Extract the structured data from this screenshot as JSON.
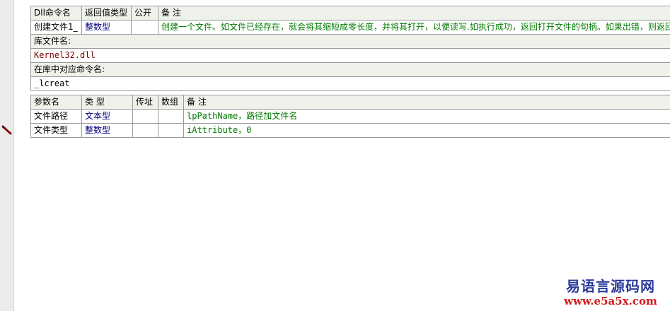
{
  "dll_header": {
    "col_name": "Dll命令名",
    "col_return": "返回值类型",
    "col_public": "公开",
    "col_remark": "备 注"
  },
  "dll_row": {
    "name": "创建文件1_",
    "return_type": "整数型",
    "public": "",
    "remark": "创建一个文件。如文件已经存在，就会将其缩短成零长度，并将其打开，以便读写.如执行成功，返回打开文件的句柄。如果出错，则返回"
  },
  "lib_label": "库文件名:",
  "lib_value": "Kernel32.dll",
  "func_label": "在库中对应命令名:",
  "func_value": "_lcreat",
  "param_header": {
    "col_name": "参数名",
    "col_type": "类 型",
    "col_byref": "传址",
    "col_array": "数组",
    "col_remark": "备 注"
  },
  "params": [
    {
      "name": "文件路径",
      "type": "文本型",
      "byref": "",
      "array": "",
      "remark": "lpPathName，路径加文件名"
    },
    {
      "name": "文件类型",
      "type": "整数型",
      "byref": "",
      "array": "",
      "remark": "iAttribute，0"
    }
  ],
  "watermark": {
    "title": "易语言源码网",
    "url": "www.e5a5x.com"
  },
  "icons": {
    "edit_marker": "pencil-icon"
  }
}
